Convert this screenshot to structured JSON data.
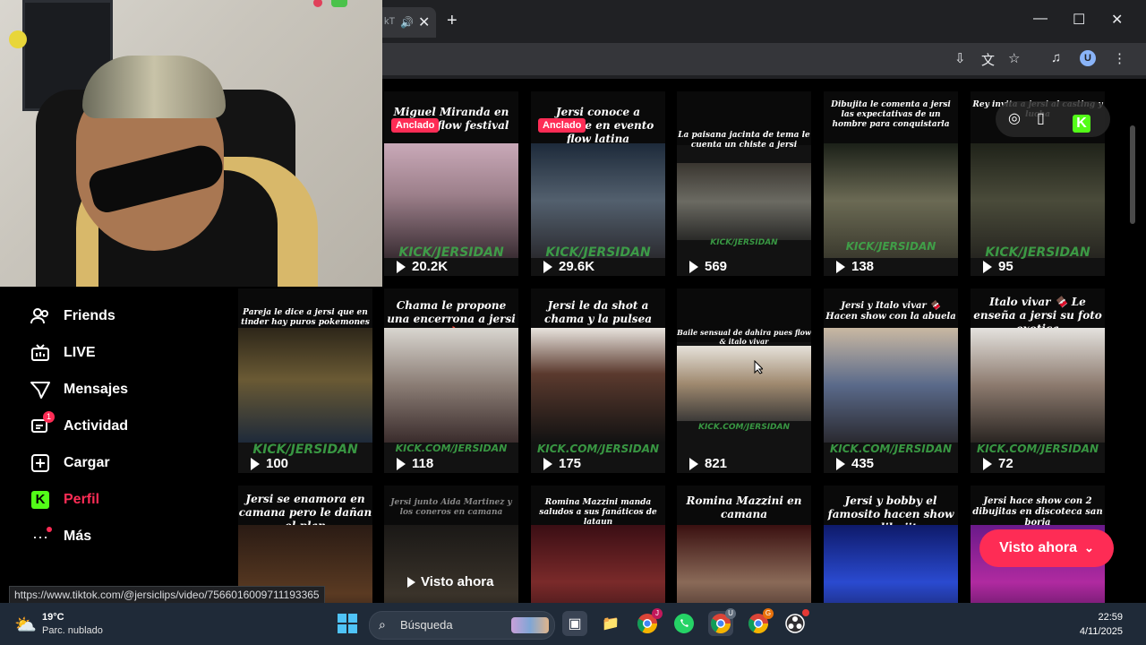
{
  "browser": {
    "tab_title": "kT",
    "tab_audio_icon": "speaker-icon",
    "tab_close": "✕",
    "new_tab": "+",
    "minimize": "—",
    "maximize": "☐",
    "close": "✕",
    "profile_initial": "U"
  },
  "sidebar": {
    "items": [
      {
        "label": "Friends",
        "icon": "friends-icon"
      },
      {
        "label": "LIVE",
        "icon": "live-tv-icon"
      },
      {
        "label": "Mensajes",
        "icon": "paper-plane-icon"
      },
      {
        "label": "Actividad",
        "icon": "activity-icon",
        "badge": "1"
      },
      {
        "label": "Cargar",
        "icon": "upload-plus-icon"
      },
      {
        "label": "Perfil",
        "icon": "kick-logo-icon",
        "active": true
      },
      {
        "label": "Más",
        "icon": "more-dots-icon"
      }
    ]
  },
  "videos": [
    {
      "caption": "Miguel Miranda en evento flow festival",
      "pinned": "Anclado",
      "watermark": "KICK/JERSIDAN",
      "views": "20.2K"
    },
    {
      "caption": "Jersi conoce a mcbride en evento flow latina",
      "pinned": "Anclado",
      "watermark": "KICK/JERSIDAN",
      "views": "29.6K"
    },
    {
      "caption": "La paisana jacinta de tema le cuenta un chiste a jersi",
      "watermark": "KICK/JERSIDAN",
      "views": "569"
    },
    {
      "caption": "Dibujita le comenta a jersi las expectativas de un hombre para conquistarla",
      "watermark": "KICK/JERSIDAN",
      "views": "138"
    },
    {
      "caption": "Rey invita a jersi al casting y lucha",
      "watermark": "KICK/JERSIDAN",
      "views": "95"
    },
    {
      "caption": "Pareja le dice a jersi que en tinder hay puros pokemones",
      "watermark": "KICK/JERSIDAN",
      "views": "100"
    },
    {
      "caption": "Chama le propone una encerrona a jersi 🔥",
      "watermark": "KICK.COM/JERSIDAN",
      "views": "118"
    },
    {
      "caption": "Jersi le da shot a chama y la pulsea",
      "watermark": "KICK.COM/JERSIDAN",
      "views": "175"
    },
    {
      "caption": "Baile sensual de dahira pues flow & italo vivar",
      "watermark": "KICK.COM/JERSIDAN",
      "views": "821"
    },
    {
      "caption": "Jersi y Italo vivar 🍫 Hacen show con la abuela",
      "watermark": "KICK.COM/JERSIDAN",
      "views": "435"
    },
    {
      "caption": "Italo vivar 🍫 Le enseña a jersi su foto exotica",
      "watermark": "KICK.COM/JERSIDAN",
      "views": "72"
    },
    {
      "caption": "Jersi se enamora en camana pero le dañan el plan",
      "watermark": "",
      "views": ""
    },
    {
      "caption": "Jersi junto Aida Martinez y los coneros en camana",
      "watermark": "",
      "views": ""
    },
    {
      "caption": "Romina Mazzini manda saludos a sus fanáticos de lataun",
      "watermark": "",
      "views": ""
    },
    {
      "caption": "Romina Mazzini en camana",
      "watermark": "",
      "views": ""
    },
    {
      "caption": "Jersi y bobby el famosito hacen show con dibujitas",
      "watermark": "",
      "views": ""
    },
    {
      "caption": "Jersi hace show con 2 dibujitas en discoteca san borja",
      "watermark": "",
      "views": ""
    }
  ],
  "overlay": {
    "watch_label": "Visto ahora"
  },
  "cta": {
    "label": "Visto ahora"
  },
  "status_url": "https://www.tiktok.com/@jersiclips/video/7566016009711193365",
  "taskbar": {
    "temp": "19°C",
    "weather": "Parc. nublado",
    "search_placeholder": "Búsqueda",
    "time": "22:59",
    "date": "4/11/2025",
    "chrome_badge_1": "J",
    "chrome_badge_2": "U",
    "chrome_badge_3": "G"
  },
  "colors": {
    "accent": "#fe2c55",
    "kick_green": "#53fc18",
    "taskbar": "#1f2a38"
  }
}
